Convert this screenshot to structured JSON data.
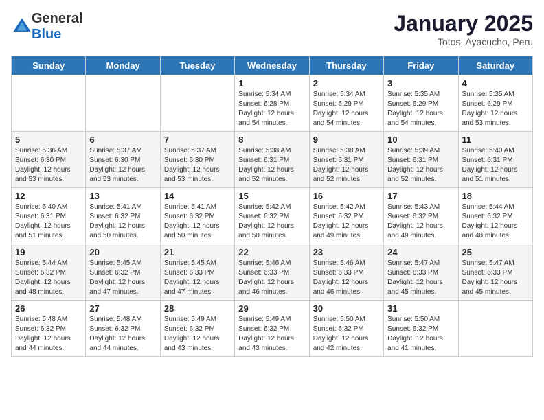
{
  "header": {
    "logo": {
      "general": "General",
      "blue": "Blue"
    },
    "title": "January 2025",
    "subtitle": "Totos, Ayacucho, Peru"
  },
  "days_of_week": [
    "Sunday",
    "Monday",
    "Tuesday",
    "Wednesday",
    "Thursday",
    "Friday",
    "Saturday"
  ],
  "weeks": [
    [
      {
        "day": "",
        "info": ""
      },
      {
        "day": "",
        "info": ""
      },
      {
        "day": "",
        "info": ""
      },
      {
        "day": "1",
        "info": "Sunrise: 5:34 AM\nSunset: 6:28 PM\nDaylight: 12 hours\nand 54 minutes."
      },
      {
        "day": "2",
        "info": "Sunrise: 5:34 AM\nSunset: 6:29 PM\nDaylight: 12 hours\nand 54 minutes."
      },
      {
        "day": "3",
        "info": "Sunrise: 5:35 AM\nSunset: 6:29 PM\nDaylight: 12 hours\nand 54 minutes."
      },
      {
        "day": "4",
        "info": "Sunrise: 5:35 AM\nSunset: 6:29 PM\nDaylight: 12 hours\nand 53 minutes."
      }
    ],
    [
      {
        "day": "5",
        "info": "Sunrise: 5:36 AM\nSunset: 6:30 PM\nDaylight: 12 hours\nand 53 minutes."
      },
      {
        "day": "6",
        "info": "Sunrise: 5:37 AM\nSunset: 6:30 PM\nDaylight: 12 hours\nand 53 minutes."
      },
      {
        "day": "7",
        "info": "Sunrise: 5:37 AM\nSunset: 6:30 PM\nDaylight: 12 hours\nand 53 minutes."
      },
      {
        "day": "8",
        "info": "Sunrise: 5:38 AM\nSunset: 6:31 PM\nDaylight: 12 hours\nand 52 minutes."
      },
      {
        "day": "9",
        "info": "Sunrise: 5:38 AM\nSunset: 6:31 PM\nDaylight: 12 hours\nand 52 minutes."
      },
      {
        "day": "10",
        "info": "Sunrise: 5:39 AM\nSunset: 6:31 PM\nDaylight: 12 hours\nand 52 minutes."
      },
      {
        "day": "11",
        "info": "Sunrise: 5:40 AM\nSunset: 6:31 PM\nDaylight: 12 hours\nand 51 minutes."
      }
    ],
    [
      {
        "day": "12",
        "info": "Sunrise: 5:40 AM\nSunset: 6:31 PM\nDaylight: 12 hours\nand 51 minutes."
      },
      {
        "day": "13",
        "info": "Sunrise: 5:41 AM\nSunset: 6:32 PM\nDaylight: 12 hours\nand 50 minutes."
      },
      {
        "day": "14",
        "info": "Sunrise: 5:41 AM\nSunset: 6:32 PM\nDaylight: 12 hours\nand 50 minutes."
      },
      {
        "day": "15",
        "info": "Sunrise: 5:42 AM\nSunset: 6:32 PM\nDaylight: 12 hours\nand 50 minutes."
      },
      {
        "day": "16",
        "info": "Sunrise: 5:42 AM\nSunset: 6:32 PM\nDaylight: 12 hours\nand 49 minutes."
      },
      {
        "day": "17",
        "info": "Sunrise: 5:43 AM\nSunset: 6:32 PM\nDaylight: 12 hours\nand 49 minutes."
      },
      {
        "day": "18",
        "info": "Sunrise: 5:44 AM\nSunset: 6:32 PM\nDaylight: 12 hours\nand 48 minutes."
      }
    ],
    [
      {
        "day": "19",
        "info": "Sunrise: 5:44 AM\nSunset: 6:32 PM\nDaylight: 12 hours\nand 48 minutes."
      },
      {
        "day": "20",
        "info": "Sunrise: 5:45 AM\nSunset: 6:32 PM\nDaylight: 12 hours\nand 47 minutes."
      },
      {
        "day": "21",
        "info": "Sunrise: 5:45 AM\nSunset: 6:33 PM\nDaylight: 12 hours\nand 47 minutes."
      },
      {
        "day": "22",
        "info": "Sunrise: 5:46 AM\nSunset: 6:33 PM\nDaylight: 12 hours\nand 46 minutes."
      },
      {
        "day": "23",
        "info": "Sunrise: 5:46 AM\nSunset: 6:33 PM\nDaylight: 12 hours\nand 46 minutes."
      },
      {
        "day": "24",
        "info": "Sunrise: 5:47 AM\nSunset: 6:33 PM\nDaylight: 12 hours\nand 45 minutes."
      },
      {
        "day": "25",
        "info": "Sunrise: 5:47 AM\nSunset: 6:33 PM\nDaylight: 12 hours\nand 45 minutes."
      }
    ],
    [
      {
        "day": "26",
        "info": "Sunrise: 5:48 AM\nSunset: 6:32 PM\nDaylight: 12 hours\nand 44 minutes."
      },
      {
        "day": "27",
        "info": "Sunrise: 5:48 AM\nSunset: 6:32 PM\nDaylight: 12 hours\nand 44 minutes."
      },
      {
        "day": "28",
        "info": "Sunrise: 5:49 AM\nSunset: 6:32 PM\nDaylight: 12 hours\nand 43 minutes."
      },
      {
        "day": "29",
        "info": "Sunrise: 5:49 AM\nSunset: 6:32 PM\nDaylight: 12 hours\nand 43 minutes."
      },
      {
        "day": "30",
        "info": "Sunrise: 5:50 AM\nSunset: 6:32 PM\nDaylight: 12 hours\nand 42 minutes."
      },
      {
        "day": "31",
        "info": "Sunrise: 5:50 AM\nSunset: 6:32 PM\nDaylight: 12 hours\nand 41 minutes."
      },
      {
        "day": "",
        "info": ""
      }
    ]
  ]
}
